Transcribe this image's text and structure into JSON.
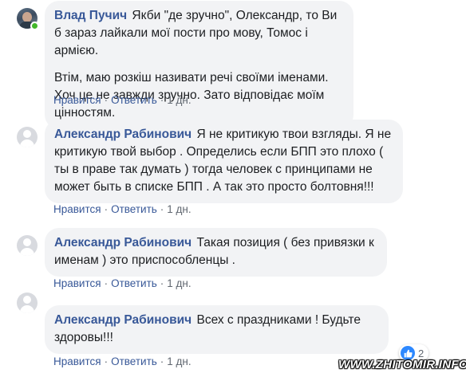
{
  "comments": [
    {
      "author": "Влад Пучич",
      "avatar": "user-photo",
      "online": true,
      "text": "Якби \"де зручно\", Олександр, то Ви б зараз лайкали мої пости про мову, Томос і армією.",
      "text2": "Втім, маю розкіш називати речі своїми іменами. Хоч це не завжди зручно. Зато відповідає моїм цінностям.",
      "like": "Нравится",
      "reply": "Ответить",
      "time": "1 дн."
    },
    {
      "author": "Александр Рабинович",
      "avatar": "default-avatar",
      "text": "Я не критикую твои взгляды. Я не критикую твой выбор . Определись если БПП это плохо ( ты в праве так думать ) тогда человек с принципами не может быть в списке БПП . А так это просто болтовня!!!",
      "like": "Нравится",
      "reply": "Ответить",
      "time": "1 дн."
    },
    {
      "author": "Александр Рабинович",
      "avatar": "default-avatar",
      "text": "Такая позиция ( без привязки к именам ) это приспособленцы .",
      "like": "Нравится",
      "reply": "Ответить",
      "time": "1 дн."
    },
    {
      "author": "Александр Рабинович",
      "avatar": "default-avatar",
      "text": "Всех с праздниками ! Будьте здоровы!!!",
      "like": "Нравится",
      "reply": "Ответить",
      "time": "1 дн.",
      "reaction_icon": "like-icon",
      "reaction_count": "2"
    }
  ],
  "watermark": "WWW.ZHITOMIR.INFO",
  "colors": {
    "author": "#385898",
    "bubble": "#f2f3f5",
    "meta": "#606770",
    "like_badge": "#2d88ff",
    "online": "#42b72a"
  }
}
